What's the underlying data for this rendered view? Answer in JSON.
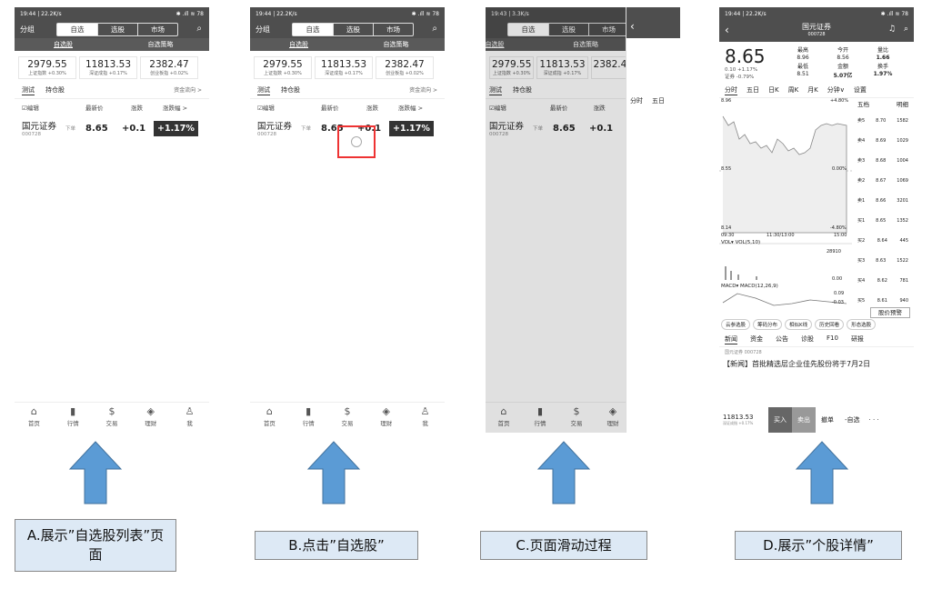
{
  "status": {
    "a": "19:44 | 22.2K/s",
    "b": "19:44 | 22.2K/s",
    "c": "19:43 | 3.3K/s",
    "d": "19:44 | 22.2K/s",
    "right": "✱ .ıll ≋ 78"
  },
  "header": {
    "group": "分组",
    "tabs": [
      "自选",
      "选股",
      "市场"
    ]
  },
  "subtabs": [
    "自选股",
    "自选策略"
  ],
  "indices": [
    {
      "value": "2979.55",
      "label": "上证指数",
      "change": "+0.30%"
    },
    {
      "value": "11813.53",
      "label": "深证成指",
      "change": "+0.17%"
    },
    {
      "value": "2382.47",
      "label": "创业板指",
      "change": "+0.02%"
    }
  ],
  "list_tabs": [
    "测试",
    "持仓股"
  ],
  "fund_flow": "资金流向 >",
  "columns": [
    "☑编辑",
    "最新价",
    "涨跌",
    "涨跌幅 >"
  ],
  "stock": {
    "name": "国元证券",
    "code": "000728",
    "tag": "下单",
    "price": "8.65",
    "change": "+0.1",
    "pct": "+1.17%"
  },
  "nav": [
    "首页",
    "行情",
    "交易",
    "理财",
    "我"
  ],
  "captions": [
    "A.展示”自选股列表”页面",
    "B.点击”自选股”",
    "C.页面滑动过程",
    "D.展示”个股详情”"
  ],
  "detail": {
    "title": "国元证券",
    "code": "000728",
    "price": "8.65",
    "chg": "0.10  +1.17%",
    "sub": "证券  -0.79%",
    "quote": [
      [
        "最高",
        "今开",
        "量比"
      ],
      [
        "8.96",
        "8.56",
        "1.66"
      ],
      [
        "最低",
        "金额",
        "换手"
      ],
      [
        "8.51",
        "5.07亿",
        "1.97%"
      ]
    ],
    "tabs": [
      "分时",
      "五日",
      "日K",
      "周K",
      "月K",
      "分钟∨",
      "设置"
    ],
    "ob_tabs": [
      "五档",
      "明细"
    ],
    "book": [
      [
        "卖5",
        "8.70",
        "1582"
      ],
      [
        "卖4",
        "8.69",
        "1029"
      ],
      [
        "卖3",
        "8.68",
        "1004"
      ],
      [
        "卖2",
        "8.67",
        "1069"
      ],
      [
        "卖1",
        "8.66",
        "3201"
      ],
      [
        "买1",
        "8.65",
        "1352"
      ],
      [
        "买2",
        "8.64",
        "445"
      ],
      [
        "买3",
        "8.63",
        "1522"
      ],
      [
        "买4",
        "8.62",
        "781"
      ],
      [
        "买5",
        "8.61",
        "940"
      ]
    ],
    "chart_labels": {
      "top": "8.96",
      "top_pct": "+4.80%",
      "mid": "8.55",
      "mid_pct": "0.00%",
      "low": "8.14",
      "low_pct": "-4.80%",
      "t0": "09:30",
      "t1": "11:30/13:00",
      "t2": "15:00",
      "vol": "VOL▾  VOL(5,10)",
      "vol_max": "28910",
      "vol_min": "0.00",
      "macd": "MACD▾  MACD(12,26,9)",
      "macd_max": "0.09",
      "macd_min": "-0.03"
    },
    "alert": "股价预警",
    "tools": [
      "云参选股",
      "筹码分布",
      "相似K线",
      "历史回看",
      "形态选股"
    ],
    "news_tabs": [
      "新闻",
      "资金",
      "公告",
      "诊股",
      "F10",
      "研报"
    ],
    "news_src": "国元证券 000728",
    "news": "【新闻】首批精选层企业佳先股份将于7月2日",
    "bottom": {
      "idx": "11813.53",
      "idx_sub": "深证成指 +0.17%",
      "buy": "买入",
      "sell": "卖出",
      "cancel": "撤单",
      "add": "-自选",
      "more": "· · ·"
    }
  }
}
